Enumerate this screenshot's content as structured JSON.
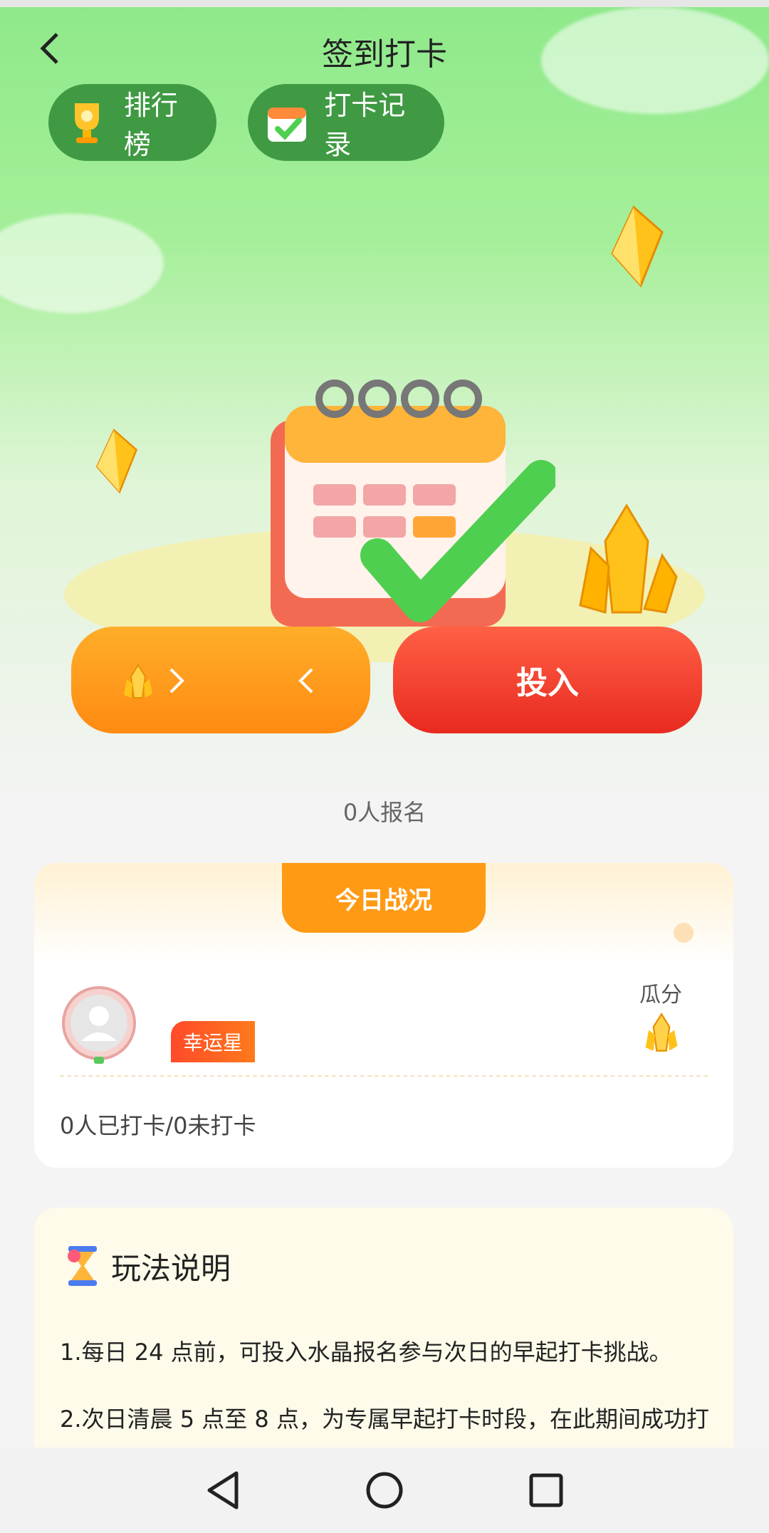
{
  "header": {
    "title": "签到打卡"
  },
  "top_buttons": {
    "rank_label": "排行榜",
    "records_label": "打卡记录"
  },
  "actions": {
    "invest_label": "投入"
  },
  "signup": {
    "count_text": "0人报名"
  },
  "today": {
    "tab_label": "今日战况",
    "lucky_label": "幸运星",
    "share_label": "瓜分",
    "stats_text": "0人已打卡/0未打卡"
  },
  "rules": {
    "title": "玩法说明",
    "items": [
      "1.每日 24 点前，可投入水晶报名参与次日的早起打卡挑战。",
      "2.次日清晨 5 点至 8 点，为专属早起打卡时段，在此期间成功打"
    ]
  },
  "colors": {
    "accent_orange": "#ff9a14",
    "invest_red": "#e82a20",
    "pill_green": "#3f9a43"
  }
}
